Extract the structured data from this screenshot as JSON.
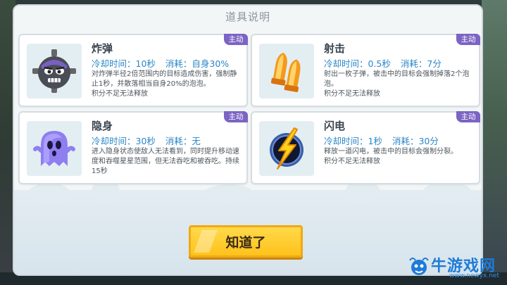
{
  "dialog": {
    "title": "道具说明",
    "confirm_label": "知道了"
  },
  "items": [
    {
      "name": "炸弹",
      "badge": "主动",
      "cooldown": "冷却时间：10秒",
      "cost": "消耗：自身30%",
      "desc": "对炸弹半径2倍范围内的目标造成伤害，强制静止1秒，并散落相当自身20%的泡泡。",
      "note": "积分不足无法释放",
      "icon": "bomb-icon"
    },
    {
      "name": "射击",
      "badge": "主动",
      "cooldown": "冷却时间：0.5秒",
      "cost": "消耗：7分",
      "desc": "射出一枚子弹，被击中的目标会强制掉落2个泡泡。",
      "note": "积分不足无法释放",
      "icon": "bullet-icon"
    },
    {
      "name": "隐身",
      "badge": "主动",
      "cooldown": "冷却时间：30秒",
      "cost": "消耗：无",
      "desc": "进入隐身状态使敌人无法看到，同时提升移动速度和吞噬星星范围，但无法吞吃和被吞吃。持续15秒",
      "note": "",
      "icon": "ghost-icon"
    },
    {
      "name": "闪电",
      "badge": "主动",
      "cooldown": "冷却时间：1秒",
      "cost": "消耗：30分",
      "desc": "释放一道闪电，被击中的目标会强制分裂。",
      "note": "积分不足无法释放",
      "icon": "lightning-icon"
    }
  ],
  "watermark": {
    "text": "牛游戏网",
    "url": "www.newyx.net"
  },
  "colors": {
    "badge": "#7b64c4",
    "stats": "#2a86c7",
    "button": "#ffc21b"
  }
}
